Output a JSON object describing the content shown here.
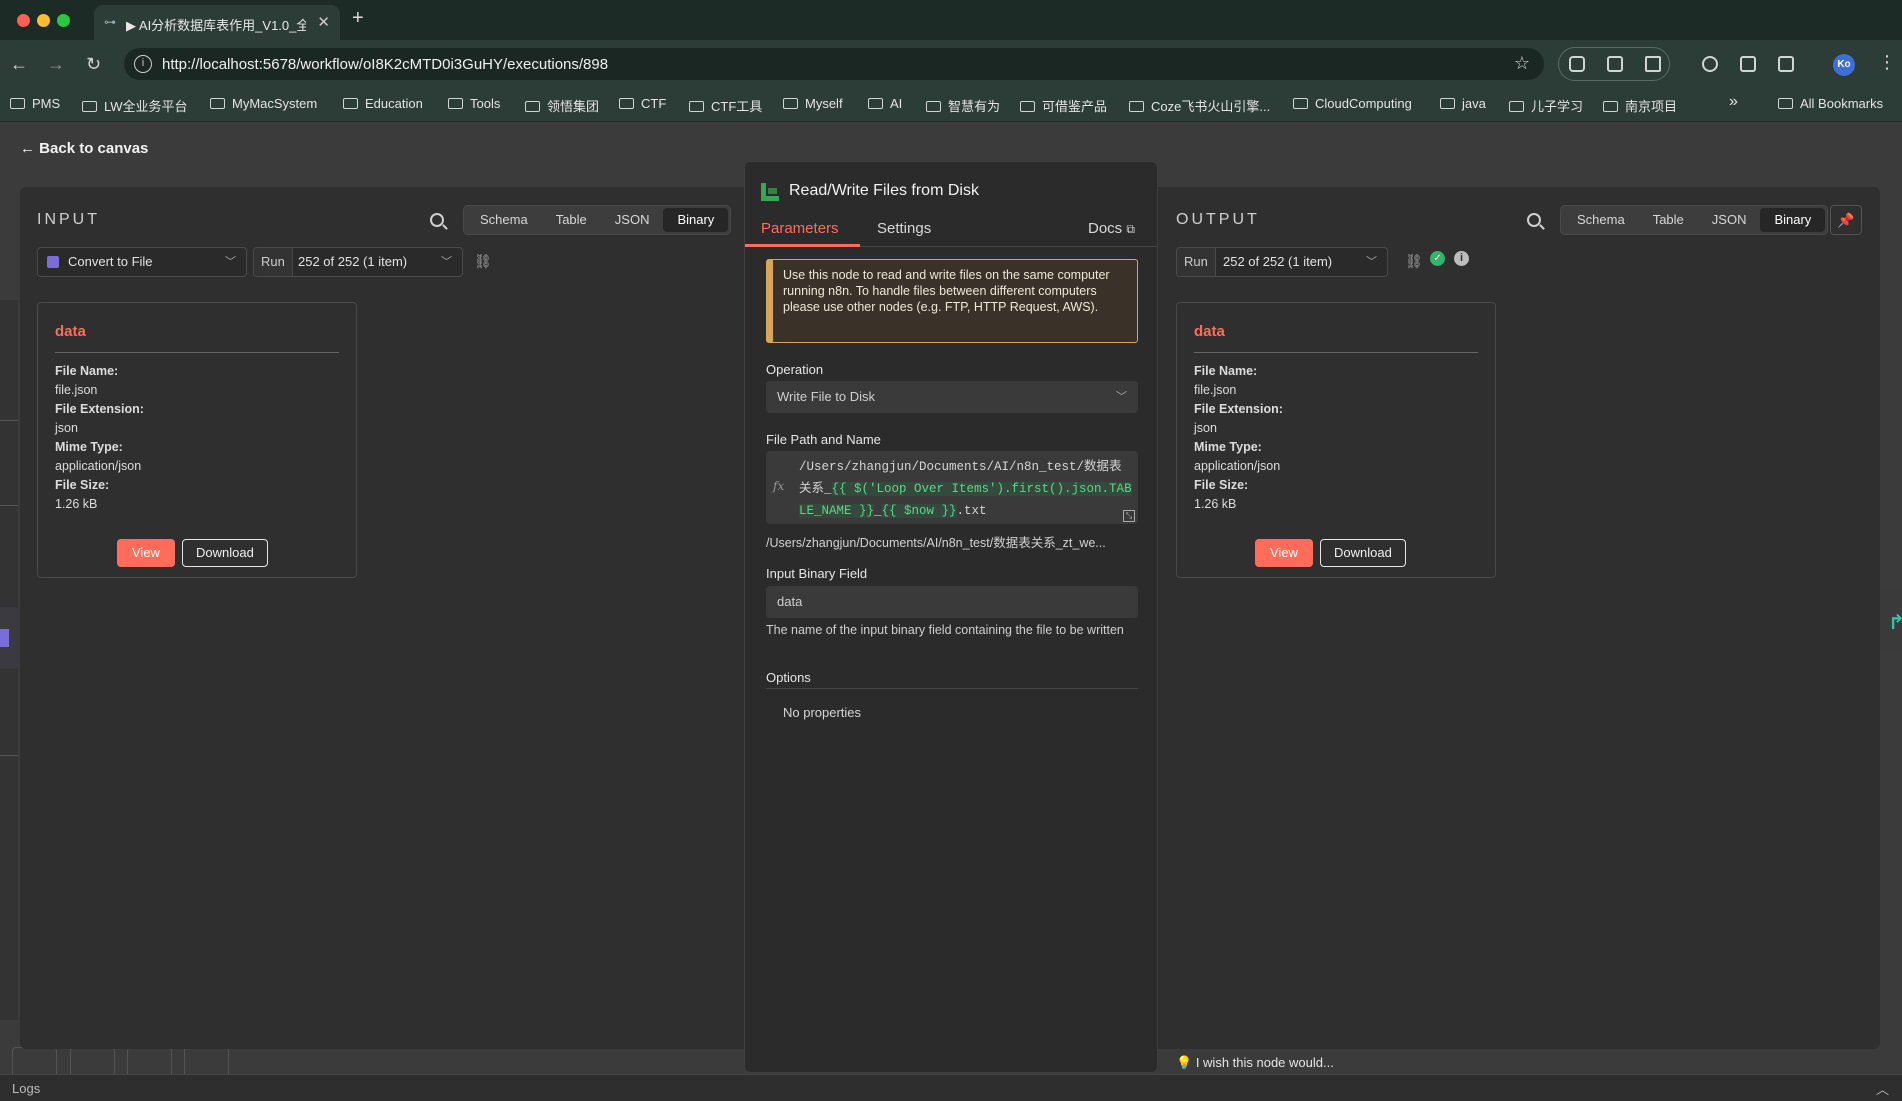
{
  "browser": {
    "tab_title": "▶ AI分析数据库表作用_V1.0_全",
    "url": "http://localhost:5678/workflow/oI8K2cMTD0i3GuHY/executions/898",
    "bookmarks": [
      "PMS",
      "LW全业务平台",
      "MyMacSystem",
      "Education",
      "Tools",
      "领悟集团",
      "CTF",
      "CTF工具",
      "Myself",
      "AI",
      "智慧有为",
      "可借鉴产品",
      "Coze飞书火山引擎...",
      "CloudComputing",
      "java",
      "儿子学习",
      "南京项目"
    ],
    "more": "»",
    "all_bookmarks": "All Bookmarks",
    "avatar_text": "Ko"
  },
  "back_to_canvas": "Back to canvas",
  "view_tabs": [
    "Schema",
    "Table",
    "JSON",
    "Binary"
  ],
  "input": {
    "title": "INPUT",
    "source_node": "Convert to File",
    "run_label": "Run",
    "run_value": "252 of 252 (1 item)"
  },
  "output": {
    "title": "OUTPUT",
    "run_label": "Run",
    "run_value": "252 of 252 (1 item)"
  },
  "binary_card": {
    "title": "data",
    "file_name_label": "File Name:",
    "file_name": "file.json",
    "file_ext_label": "File Extension:",
    "file_ext": "json",
    "mime_label": "Mime Type:",
    "mime": "application/json",
    "size_label": "File Size:",
    "size": "1.26 kB",
    "view": "View",
    "download": "Download"
  },
  "node": {
    "title": "Read/Write Files from Disk",
    "tabs": {
      "parameters": "Parameters",
      "settings": "Settings",
      "docs": "Docs"
    },
    "notice": "Use this node to read and write files on the same computer running n8n. To handle files between different computers please use other nodes (e.g. FTP, HTTP Request, AWS).",
    "operation_label": "Operation",
    "operation_value": "Write File to Disk",
    "path_label": "File Path and Name",
    "path_expr": {
      "plain1": "/Users/zhangjun/Documents/AI/n8n_test/数据表关系_",
      "expr1": "{{ $('Loop Over Items').first().json.TABLE_NAME }}",
      "plain2": "_",
      "expr2": "{{ $now }}",
      "plain3": ".txt"
    },
    "fx": "fx",
    "path_preview": "/Users/zhangjun/Documents/AI/n8n_test/数据表关系_zt_we...",
    "binary_field_label": "Input Binary Field",
    "binary_field_value": "data",
    "binary_field_hint": "The name of the input binary field containing the file to be written",
    "options_label": "Options",
    "no_properties": "No properties"
  },
  "wish": "I wish this node would...",
  "logs": "Logs",
  "colors": {
    "accent": "#ff6d5a",
    "success": "#33b36b",
    "warning": "#d9a55b",
    "node_icon": "#34a853"
  }
}
